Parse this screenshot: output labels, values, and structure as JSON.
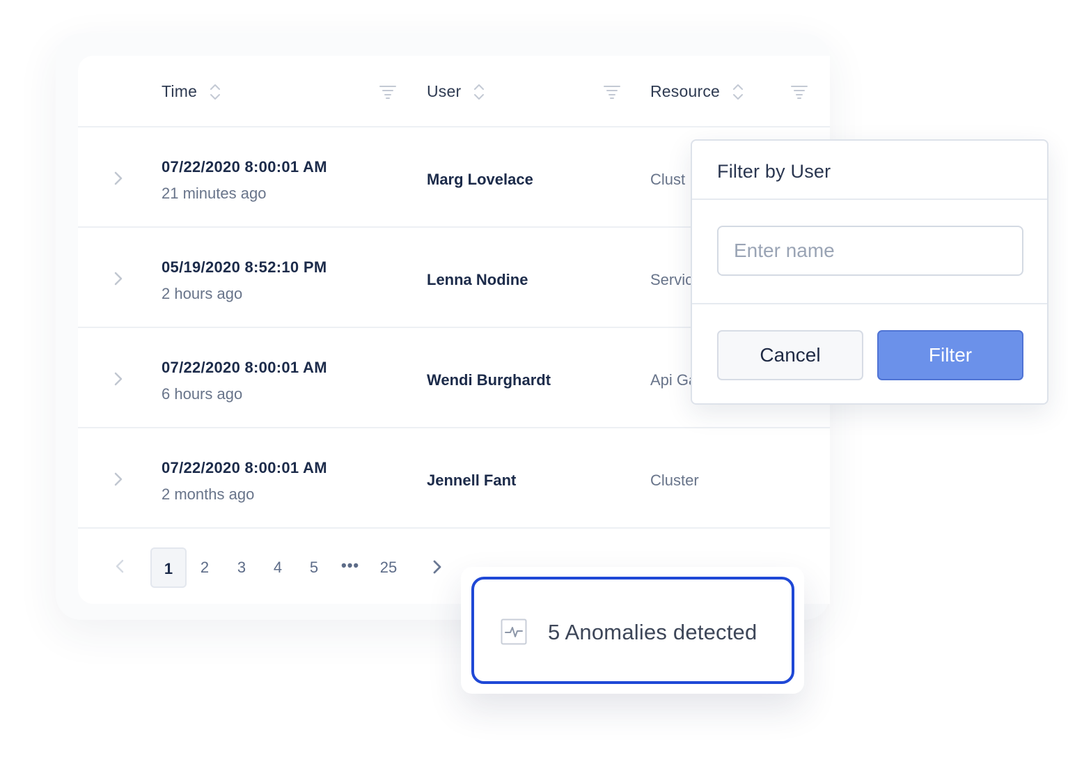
{
  "table": {
    "columns": [
      {
        "label": "Time"
      },
      {
        "label": "User"
      },
      {
        "label": "Resource"
      }
    ],
    "rows": [
      {
        "time": "07/22/2020 8:00:01 AM",
        "relative": "21 minutes ago",
        "user": "Marg Lovelace",
        "resource": "Clust"
      },
      {
        "time": "05/19/2020 8:52:10 PM",
        "relative": "2 hours ago",
        "user": "Lenna Nodine",
        "resource": "Servic"
      },
      {
        "time": "07/22/2020 8:00:01 AM",
        "relative": "6 hours ago",
        "user": "Wendi Burghardt",
        "resource": "Api Ga"
      },
      {
        "time": "07/22/2020 8:00:01 AM",
        "relative": "2 months ago",
        "user": "Jennell Fant",
        "resource": "Cluster"
      }
    ]
  },
  "pagination": {
    "pages": [
      "1",
      "2",
      "3",
      "4",
      "5"
    ],
    "ellipsis": "•••",
    "last": "25",
    "current": "1"
  },
  "filter_popup": {
    "title": "Filter by User",
    "placeholder": "Enter name",
    "value": "",
    "cancel_label": "Cancel",
    "filter_label": "Filter"
  },
  "toast": {
    "icon": "activity-icon",
    "text": "5 Anomalies detected"
  },
  "colors": {
    "accent": "#6b91ea",
    "toast_border": "#1f48d6",
    "text_dark": "#1c2b4a",
    "text_muted": "#68748a"
  }
}
